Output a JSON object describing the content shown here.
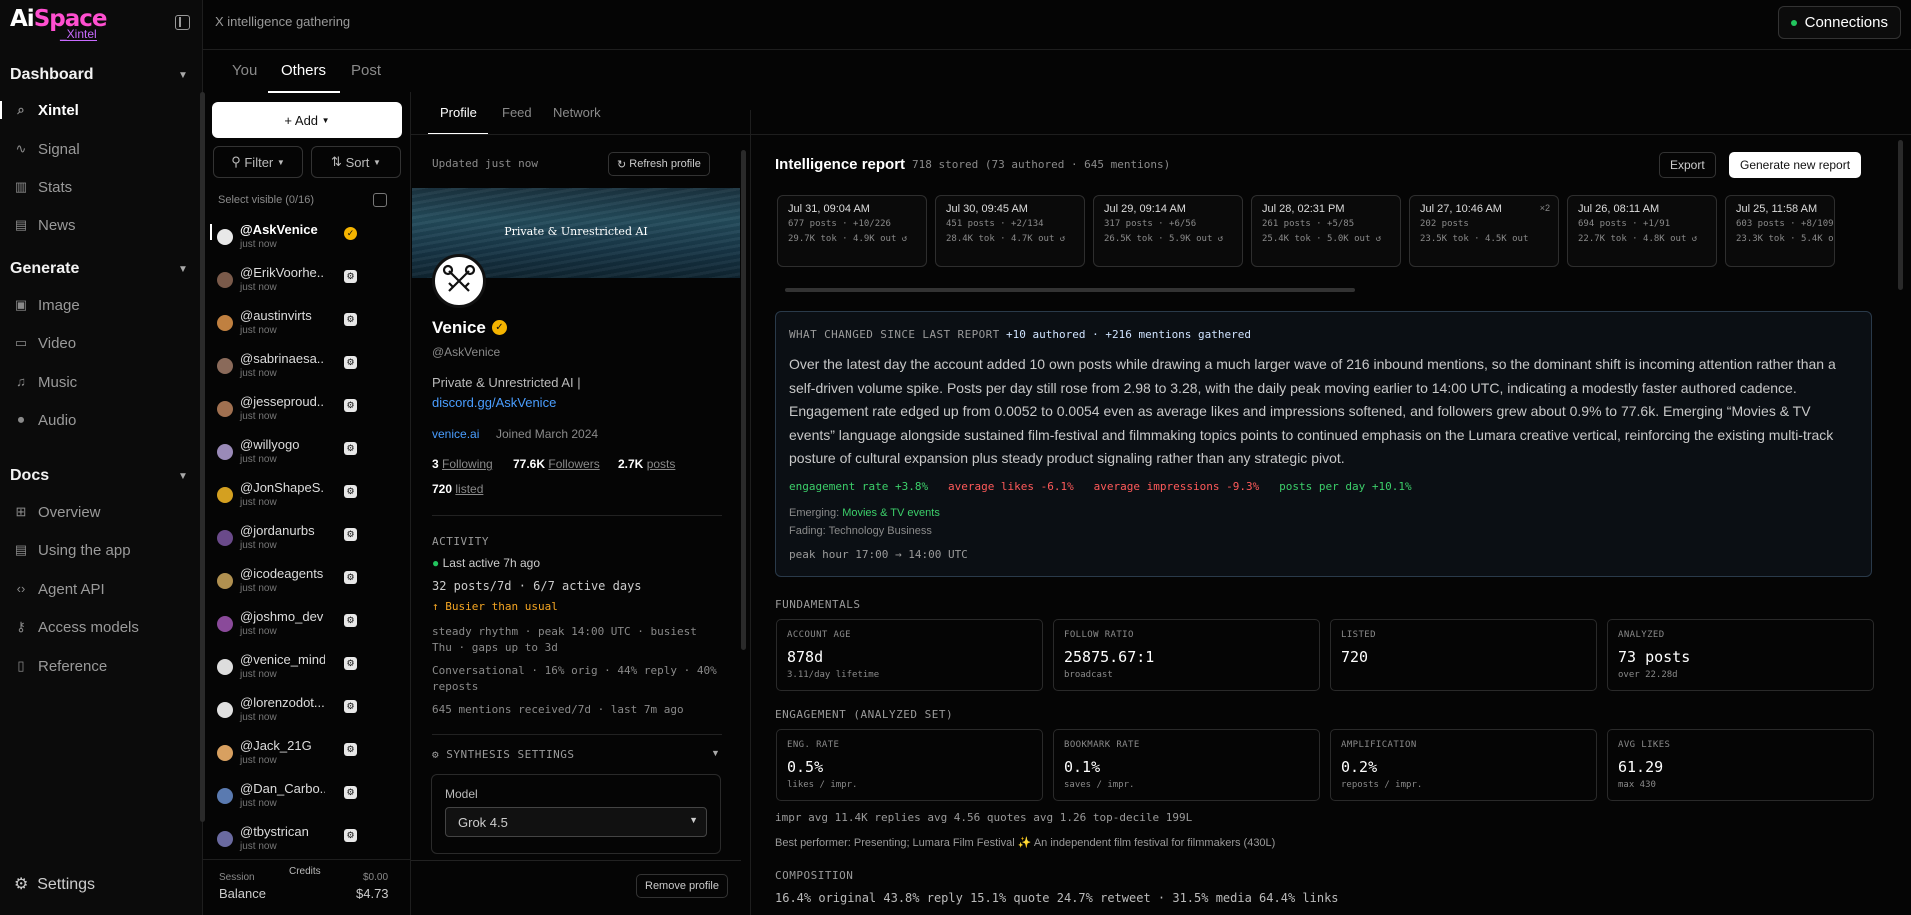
{
  "app": {
    "logo_main": "AiSpace",
    "logo_sub": "_Xintel"
  },
  "nav": {
    "dashboard": "Dashboard",
    "dashboard_items": [
      {
        "label": "Xintel",
        "icon": "search-icon"
      },
      {
        "label": "Signal",
        "icon": "signal-icon"
      },
      {
        "label": "Stats",
        "icon": "stats-icon"
      },
      {
        "label": "News",
        "icon": "news-icon"
      }
    ],
    "generate": "Generate",
    "generate_items": [
      {
        "label": "Image",
        "icon": "image-icon"
      },
      {
        "label": "Video",
        "icon": "video-icon"
      },
      {
        "label": "Music",
        "icon": "music-icon"
      },
      {
        "label": "Audio",
        "icon": "mic-icon"
      }
    ],
    "docs": "Docs",
    "docs_items": [
      {
        "label": "Overview",
        "icon": "grid-icon"
      },
      {
        "label": "Using the app",
        "icon": "book-icon"
      },
      {
        "label": "Agent API",
        "icon": "code-icon"
      },
      {
        "label": "Access models",
        "icon": "key-icon"
      },
      {
        "label": "Reference",
        "icon": "reference-icon"
      }
    ],
    "settings": "Settings"
  },
  "topbar": {
    "breadcrumb": "X intelligence gathering",
    "connections": "Connections"
  },
  "main_tabs": [
    "You",
    "Others",
    "Post"
  ],
  "accounts": {
    "add": "+ Add",
    "filter": "Filter",
    "sort": "Sort",
    "select_visible": "Select visible (0/16)",
    "list": [
      {
        "handle": "@AskVenice",
        "status": "just now"
      },
      {
        "handle": "@ErikVoorhe...",
        "status": "just now"
      },
      {
        "handle": "@austinvirts",
        "status": "just now"
      },
      {
        "handle": "@sabrinaesa...",
        "status": "just now"
      },
      {
        "handle": "@jesseproud...",
        "status": "just now"
      },
      {
        "handle": "@willyogo",
        "status": "just now"
      },
      {
        "handle": "@JonShapeS...",
        "status": "just now"
      },
      {
        "handle": "@jordanurbs",
        "status": "just now"
      },
      {
        "handle": "@icodeagents",
        "status": "just now"
      },
      {
        "handle": "@joshmo_dev",
        "status": "just now"
      },
      {
        "handle": "@venice_mind",
        "status": "just now"
      },
      {
        "handle": "@lorenzodot...",
        "status": "just now"
      },
      {
        "handle": "@Jack_21G",
        "status": "just now"
      },
      {
        "handle": "@Dan_Carbo...",
        "status": "just now"
      },
      {
        "handle": "@tbystrican",
        "status": "just now"
      }
    ],
    "balance": {
      "session": "Session",
      "credits": "Credits",
      "session_val": "$0.00",
      "balance": "Balance",
      "balance_val": "$4.73"
    }
  },
  "profile_tabs": [
    "Profile",
    "Feed",
    "Network"
  ],
  "profile": {
    "updated": "Updated just now",
    "refresh": "Refresh profile",
    "banner_text": "Private & Unrestricted AI",
    "name": "Venice",
    "handle": "@AskVenice",
    "bio": "Private & Unrestricted AI |",
    "bio_link": "discord.gg/AskVenice",
    "site": "venice.ai",
    "joined": "Joined March 2024",
    "following_n": "3",
    "following": "Following",
    "followers_n": "77.6K",
    "followers": "Followers",
    "posts_n": "2.7K",
    "posts": "posts",
    "listed_n": "720",
    "listed": "listed",
    "activity_title": "ACTIVITY",
    "last_active": "Last active 7h ago",
    "rate": "32 posts/7d · 6/7 active days",
    "busy": "↑ Busier than usual",
    "rhythm": "steady rhythm · peak 14:00 UTC · busiest Thu · gaps up to 3d",
    "mix": "Conversational · 16% orig · 44% reply · 40% reposts",
    "mentions": "645 mentions received/7d · last 7m ago",
    "synthesis": "SYNTHESIS SETTINGS",
    "model_label": "Model",
    "model_value": "Grok 4.5",
    "remove": "Remove profile"
  },
  "report": {
    "title": "Intelligence report",
    "subtitle": "718 stored (73 authored · 645 mentions)",
    "export": "Export",
    "generate": "Generate new report",
    "snapshots": [
      {
        "date": "Jul 31, 09:04 AM",
        "l1": "677 posts · +10/226",
        "l2": "29.7K tok · 4.9K out ↺"
      },
      {
        "date": "Jul 30, 09:45 AM",
        "l1": "451 posts · +2/134",
        "l2": "28.4K tok · 4.7K out ↺"
      },
      {
        "date": "Jul 29, 09:14 AM",
        "l1": "317 posts · +6/56",
        "l2": "26.5K tok · 5.9K out ↺"
      },
      {
        "date": "Jul 28, 02:31 PM",
        "l1": "261 posts · +5/85",
        "l2": "25.4K tok · 5.0K out ↺"
      },
      {
        "date": "Jul 27, 10:46 AM",
        "l1": "202 posts",
        "l2": "23.5K tok · 4.5K out",
        "extra": "×2"
      },
      {
        "date": "Jul 26, 08:11 AM",
        "l1": "694 posts · +1/91",
        "l2": "22.7K tok · 4.8K out ↺"
      },
      {
        "date": "Jul 25, 11:58 AM",
        "l1": "603 posts · +8/109",
        "l2": "23.3K tok · 5.4K out ↺"
      }
    ],
    "changed": {
      "heading": "WHAT CHANGED SINCE LAST REPORT",
      "tag": "+10 authored · +216 mentions gathered",
      "paragraph": "Over the latest day the account added 10 own posts while drawing a much larger wave of 216 inbound mentions, so the dominant shift is incoming attention rather than a self-driven volume spike. Posts per day still rose from 2.98 to 3.28, with the daily peak moving earlier to 14:00 UTC, indicating a modestly faster authored cadence. Engagement rate edged up from 0.0052 to 0.0054 even as average likes and impressions softened, and followers grew about 0.9% to 77.6k. Emerging “Movies & TV events” language alongside sustained film-festival and filmmaking topics points to continued emphasis on the Lumara creative vertical, reinforcing the existing multi-track posture of cultural expansion plus steady product signaling rather than any strategic pivot.",
      "chip1": "engagement rate +3.8%",
      "chip2": "average likes -6.1%",
      "chip3": "average impressions -9.3%",
      "chip4": "posts per day +10.1%",
      "emerging_label": "Emerging:",
      "emerging": "Movies & TV events",
      "fading_label": "Fading:",
      "fading": "Technology Business",
      "peak": "peak hour 17:00 → 14:00 UTC"
    },
    "fundamentals_title": "FUNDAMENTALS",
    "fundamentals": [
      {
        "k": "ACCOUNT AGE",
        "v": "878d",
        "s": "3.11/day lifetime"
      },
      {
        "k": "FOLLOW RATIO",
        "v": "25875.67:1",
        "s": "broadcast"
      },
      {
        "k": "LISTED",
        "v": "720",
        "s": ""
      },
      {
        "k": "ANALYZED",
        "v": "73 posts",
        "s": "over 22.28d"
      }
    ],
    "engagement_title": "ENGAGEMENT (ANALYZED SET)",
    "engagement": [
      {
        "k": "ENG. RATE",
        "v": "0.5%",
        "s": "likes / impr."
      },
      {
        "k": "BOOKMARK RATE",
        "v": "0.1%",
        "s": "saves / impr."
      },
      {
        "k": "AMPLIFICATION",
        "v": "0.2%",
        "s": "reposts / impr."
      },
      {
        "k": "AVG LIKES",
        "v": "61.29",
        "s": "max 430"
      }
    ],
    "eng_line": "impr avg 11.4K   replies avg 4.56   quotes avg 1.26   top-decile 199L",
    "best": "Best performer: Presenting; Lumara Film Festival ✨ An independent film festival for filmmakers (430L)",
    "composition_title": "COMPOSITION",
    "composition": "16.4% original  43.8% reply  15.1% quote  24.7% retweet  · 31.5% media  64.4% links"
  }
}
